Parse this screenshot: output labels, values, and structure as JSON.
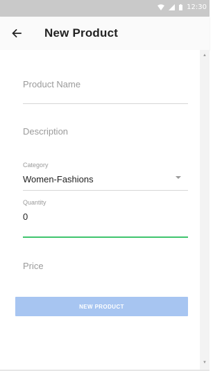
{
  "status_bar": {
    "time": "12:30",
    "icons": [
      "wifi-icon",
      "signal-icon",
      "battery-icon"
    ]
  },
  "app_bar": {
    "title": "New Product",
    "back_icon": "arrow-left-icon"
  },
  "form": {
    "product_name": {
      "placeholder": "Product Name",
      "value": ""
    },
    "description": {
      "placeholder": "Description",
      "value": ""
    },
    "category": {
      "label": "Category",
      "selected": "Women-Fashions"
    },
    "quantity": {
      "label": "Quantity",
      "value": "0"
    },
    "price": {
      "placeholder": "Price",
      "value": ""
    },
    "submit_label": "NEW PRODUCT"
  },
  "colors": {
    "status_bar": "#c9c9c9",
    "focus_underline": "#3ec46d",
    "button_bg": "#a7c5f1"
  }
}
